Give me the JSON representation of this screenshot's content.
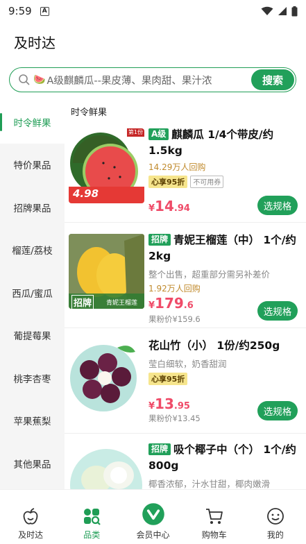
{
  "status": {
    "time": "9:59",
    "a_icon": "A"
  },
  "app_title": "及时达",
  "search": {
    "emoji": "🍉",
    "placeholder": "A级麒麟瓜--果皮薄、果肉甜、果汁浓",
    "button": "搜索"
  },
  "sidebar": {
    "items": [
      {
        "label": "时令鲜果",
        "active": true
      },
      {
        "label": "特价果品"
      },
      {
        "label": "招牌果品"
      },
      {
        "label": "榴莲/荔枝"
      },
      {
        "label": "西瓜/蜜瓜"
      },
      {
        "label": "葡提莓果"
      },
      {
        "label": "桃李杏枣"
      },
      {
        "label": "苹果蕉梨"
      },
      {
        "label": "其他果品"
      }
    ]
  },
  "section_title": "时令鲜果",
  "products": [
    {
      "tag": "A级",
      "name": "麒麟瓜 1/4个带皮/约1.5kg",
      "sales": "14.29万人回购",
      "vip": "心享95折",
      "nocoupon": "不可用券",
      "price_sym": "¥",
      "price_int": "14",
      "price_dec": ".94",
      "button": "选规格",
      "img_label": "4.98",
      "img_corner": "第1份"
    },
    {
      "tag": "招牌",
      "name": "青妮王榴莲（中） 1个/约2kg",
      "desc": "整个出售，超重部分需另补差价",
      "sales": "1.92万人回购",
      "price_sym": "¥",
      "price_int": "179",
      "price_dec": ".6",
      "ref": "果粉价¥159.6",
      "button": "选规格",
      "img_label": "招牌",
      "img_sub": "青妮王榴莲"
    },
    {
      "name": "花山竹（小） 1份/约250g",
      "desc": "莹白细软，奶香甜润",
      "vip": "心享95折",
      "price_sym": "¥",
      "price_int": "13",
      "price_dec": ".95",
      "ref": "果粉价¥13.45",
      "button": "选规格"
    },
    {
      "tag": "招牌",
      "name": "吸个椰子中（个） 1个/约800g",
      "desc": "椰香浓郁，汁水甘甜，椰肉嫩滑"
    }
  ],
  "nav": [
    {
      "label": "及时达",
      "icon": "apple-icon"
    },
    {
      "label": "品类",
      "icon": "category-icon",
      "active": true
    },
    {
      "label": "会员中心",
      "icon": "vip-icon"
    },
    {
      "label": "购物车",
      "icon": "cart-icon"
    },
    {
      "label": "我的",
      "icon": "profile-icon"
    }
  ],
  "colors": {
    "brand": "#21a05a",
    "price": "#ef4b68",
    "sales": "#c08a2c"
  }
}
